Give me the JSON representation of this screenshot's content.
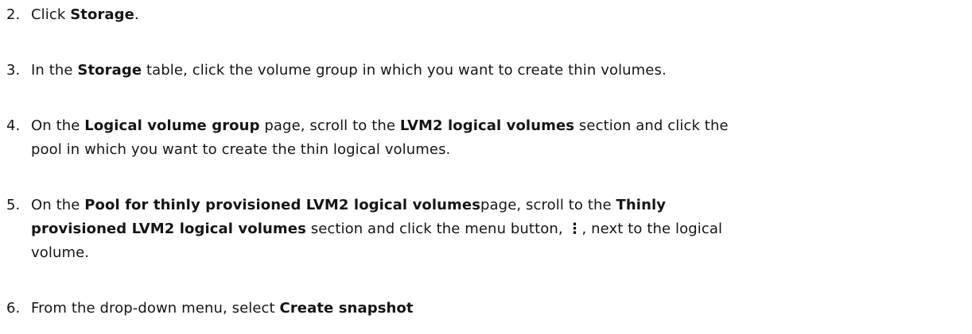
{
  "steps": [
    {
      "num": "2.",
      "parts": [
        {
          "t": "Click "
        },
        {
          "b": "Storage"
        },
        {
          "t": "."
        }
      ]
    },
    {
      "num": "3.",
      "parts": [
        {
          "t": "In the "
        },
        {
          "b": "Storage"
        },
        {
          "t": " table, click the volume group in which you want to create thin volumes."
        }
      ]
    },
    {
      "num": "4.",
      "line1": [
        {
          "t": "On the "
        },
        {
          "b": "Logical volume group"
        },
        {
          "t": " page, scroll to the  "
        },
        {
          "b": "LVM2 logical volumes"
        },
        {
          "t": " section and click the"
        }
      ],
      "line2": [
        {
          "t": "pool in which you want to create the thin logical volumes."
        }
      ]
    },
    {
      "num": "5.",
      "line1": [
        {
          "t": "On the "
        },
        {
          "b": "Pool for thinly provisioned LVM2 logical volumes"
        },
        {
          "t": "page, scroll to the  "
        },
        {
          "b": "Thinly"
        }
      ],
      "line2": [
        {
          "b": "provisioned LVM2 logical volumes"
        },
        {
          "t": " section and click the menu button,  "
        },
        {
          "icon": "⋮"
        },
        {
          "t": ", next to the logical"
        }
      ],
      "line3": [
        {
          "t": "volume."
        }
      ]
    },
    {
      "num": "6.",
      "parts": [
        {
          "t": "From the drop-down menu, select "
        },
        {
          "b": "Create snapshot"
        }
      ]
    }
  ],
  "icons": {
    "kebab": "kebab-menu-icon"
  }
}
